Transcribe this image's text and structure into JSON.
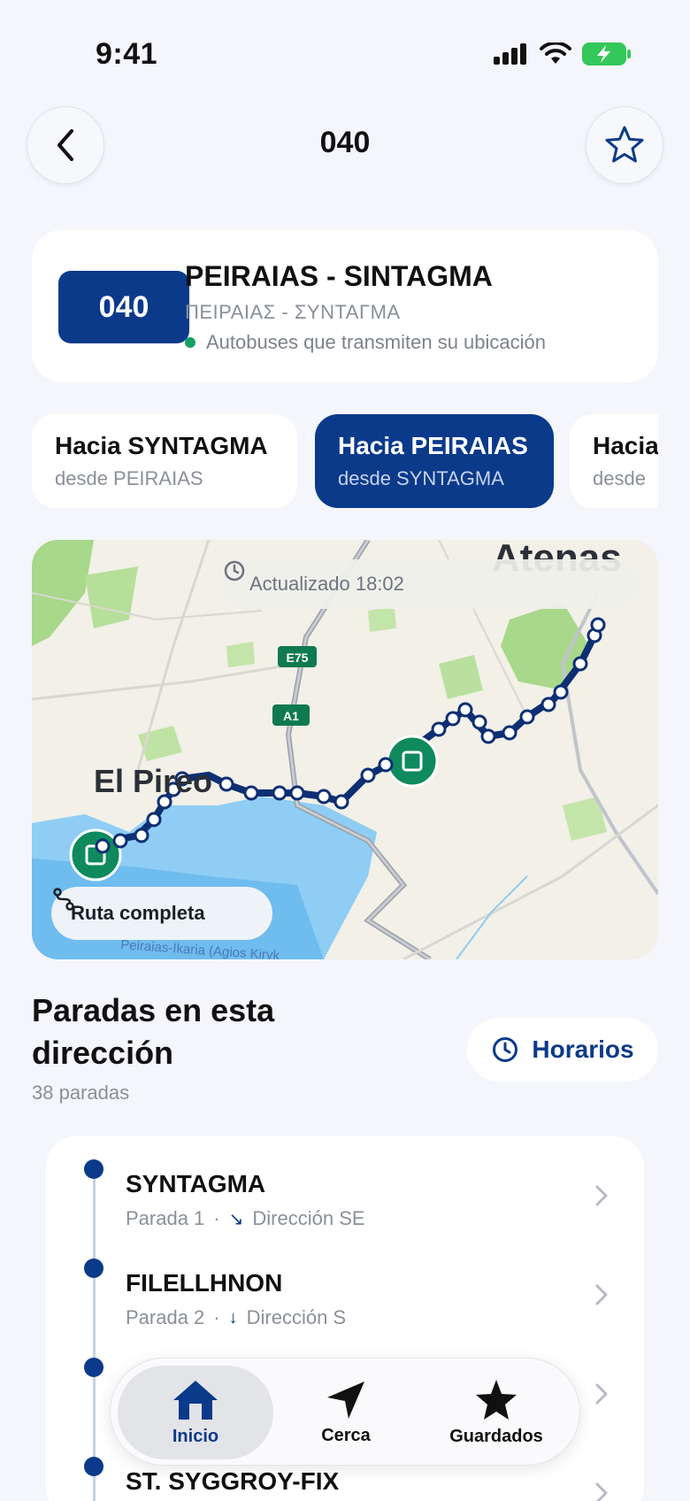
{
  "status": {
    "time": "9:41"
  },
  "header": {
    "title": "040"
  },
  "route": {
    "badge": "040",
    "name": "PEIRAIAS - SINTAGMA",
    "greek_name": "ΠΕΙΡΑΙΑΣ - ΣΥΝΤΑΓΜΑ",
    "live_text": "Autobuses que transmiten su ubicación",
    "accent_color": "#0b3a8a",
    "live_color": "#17a064"
  },
  "directions": [
    {
      "title": "Hacia SYNTAGMA",
      "subtitle": "desde PEIRAIAS",
      "active": false
    },
    {
      "title": "Hacia PEIRAIAS",
      "subtitle": "desde SYNTAGMA",
      "active": true
    },
    {
      "title": "Hacia",
      "subtitle": "desde",
      "active": false
    }
  ],
  "map": {
    "updated": "Actualizado 18:02",
    "full_route": "Ruta completa",
    "city_label": "El Pireo",
    "top_label": "Atenas",
    "road_label_1": "E75",
    "road_label_2": "A1",
    "street_label": "Peiraias-Ikaria (Agios Kiryk"
  },
  "stops_section": {
    "title": "Paradas en esta dirección",
    "count": "38 paradas",
    "schedule_button": "Horarios"
  },
  "stops": [
    {
      "name": "SYNTAGMA",
      "number": "Parada 1",
      "separator": "·",
      "arrow": "↘",
      "direction": "Dirección SE"
    },
    {
      "name": "FILELLHNON",
      "number": "Parada 2",
      "separator": "·",
      "arrow": "↓",
      "direction": "Dirección S"
    },
    {
      "name": "",
      "number": "",
      "separator": "",
      "arrow": "",
      "direction": ""
    },
    {
      "name": "ST. SYGGROY-FIX",
      "number": "",
      "separator": "",
      "arrow": "",
      "direction": ""
    }
  ],
  "tabbar": {
    "home": "Inicio",
    "nearby": "Cerca",
    "saved": "Guardados"
  }
}
